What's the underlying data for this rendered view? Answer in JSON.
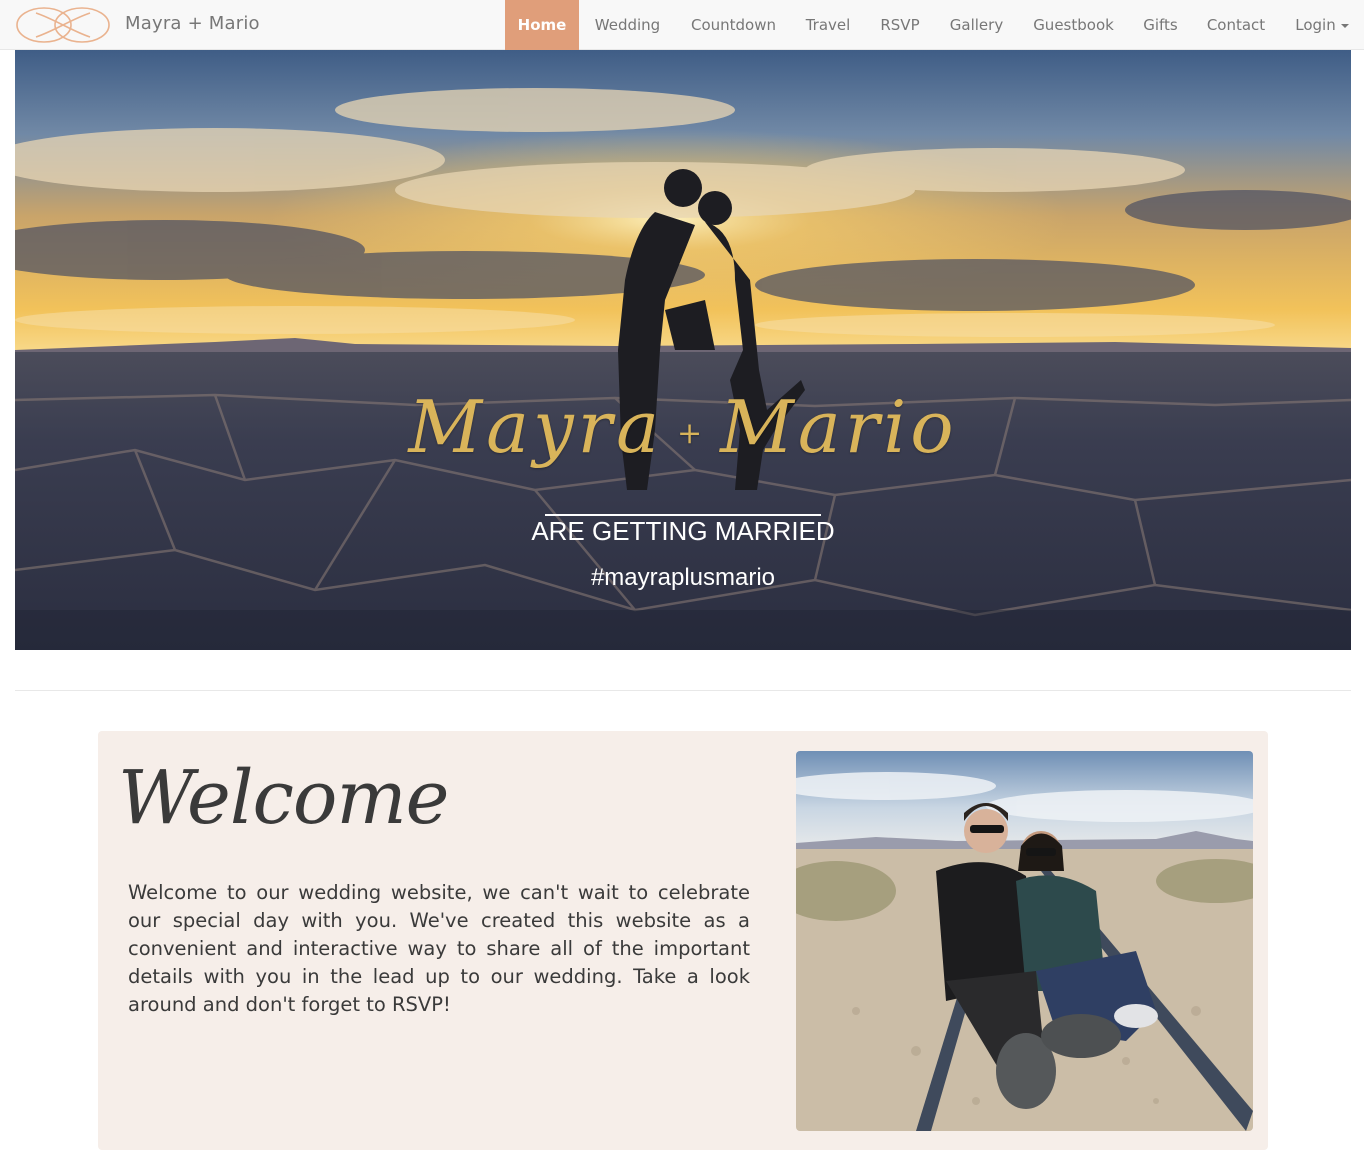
{
  "navbar": {
    "brand": "Mayra + Mario",
    "items": [
      {
        "label": "Home",
        "active": true
      },
      {
        "label": "Wedding"
      },
      {
        "label": "Countdown"
      },
      {
        "label": "Travel"
      },
      {
        "label": "RSVP"
      },
      {
        "label": "Gallery"
      },
      {
        "label": "Guestbook"
      },
      {
        "label": "Gifts"
      },
      {
        "label": "Contact"
      },
      {
        "label": "Login"
      }
    ],
    "active_color": "#e09e7a"
  },
  "hero": {
    "name_left": "Mayra",
    "plus": "+",
    "name_right": "Mario",
    "subtitle": "ARE GETTING MARRIED",
    "hashtag": "#mayraplusmario"
  },
  "welcome": {
    "title": "Welcome",
    "body": "Welcome to our wedding website, we can't wait to celebrate our special day with you. We've created this website as a convenient and interactive way to share all of the important details with you in the lead up to our wedding. Take a look around and don't forget to RSVP!",
    "background": "#f6eee9"
  }
}
